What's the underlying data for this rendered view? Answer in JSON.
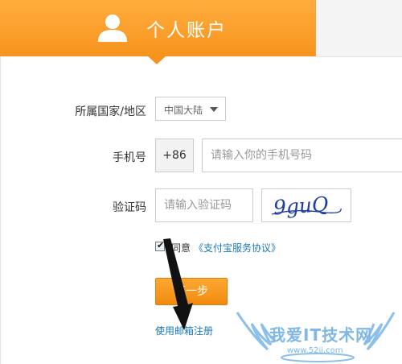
{
  "header": {
    "tab_title": "个人账户"
  },
  "form": {
    "country_label": "所属国家/地区",
    "country_value": "中国大陆",
    "phone_label": "手机号",
    "phone_prefix": "+86",
    "phone_placeholder": "请输入你的手机号码",
    "captcha_label": "验证码",
    "captcha_placeholder": "请输入验证码",
    "captcha_text": "9guQ",
    "agree_checked": true,
    "agree_text": "同意",
    "agree_link": "《支付宝服务协议》",
    "next_button": "下一步",
    "email_register_link": "使用邮箱注册"
  },
  "watermark": {
    "text": "我爱IT技术网",
    "url": "www.52ij.com"
  },
  "colors": {
    "accent": "#f7931e",
    "link": "#1a7ab8"
  }
}
